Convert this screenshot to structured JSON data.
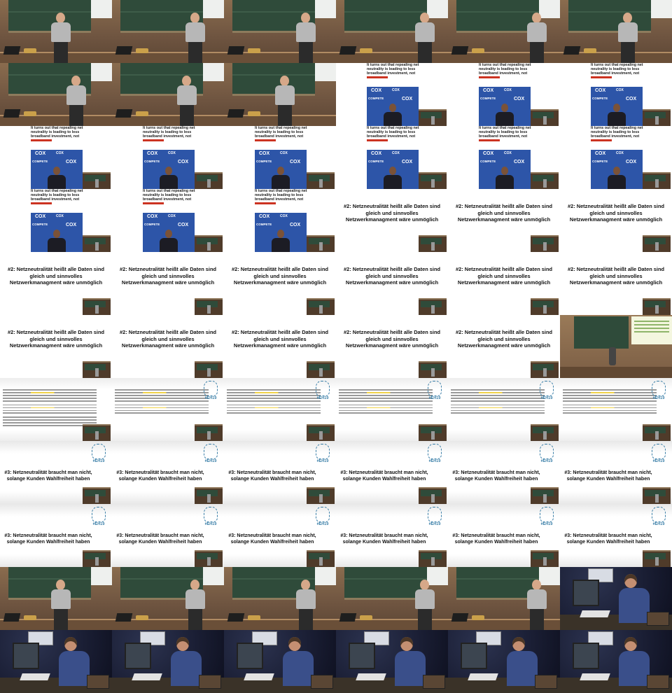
{
  "article_slide": {
    "headline": "It turns out that repealing net neutrality is leading to less broadband investment, not more",
    "logo_left": "COX",
    "logo_center": "COMPETE",
    "logo_right": "COX"
  },
  "myth2_slide": {
    "caption": "#2: Netzneutralität heißt alle Daten sind gleich und sinnvolles Netzwerkmanagment wäre unmöglich"
  },
  "myth3_slide": {
    "caption": "#3: Netzneutralität braucht man nicht, solange Kunden Wahlfreiheit haben"
  },
  "event_logo": {
    "tag": "#EH19"
  },
  "tiles": [
    "lecture",
    "lecture",
    "lecture",
    "lecture",
    "lecture",
    "lecture",
    "lecture",
    "lecture",
    "lecture",
    "article",
    "article",
    "article",
    "article",
    "article",
    "article",
    "article",
    "article",
    "article",
    "article",
    "article",
    "article",
    "myth2",
    "myth2",
    "myth2",
    "myth2",
    "myth2",
    "myth2",
    "myth2",
    "myth2",
    "myth2",
    "myth2",
    "myth2",
    "myth2",
    "myth2",
    "myth2",
    "wide",
    "doc",
    "doc-eh",
    "doc-eh",
    "doc-eh",
    "doc-eh",
    "doc-eh",
    "myth3",
    "myth3",
    "myth3",
    "myth3",
    "myth3",
    "myth3",
    "myth3",
    "myth3",
    "myth3",
    "myth3",
    "myth3",
    "myth3",
    "lecture",
    "lecture",
    "lecture",
    "lecture",
    "lecture",
    "deskshot",
    "deskshot",
    "deskshot",
    "deskshot",
    "deskshot",
    "deskshot",
    "deskshot"
  ]
}
